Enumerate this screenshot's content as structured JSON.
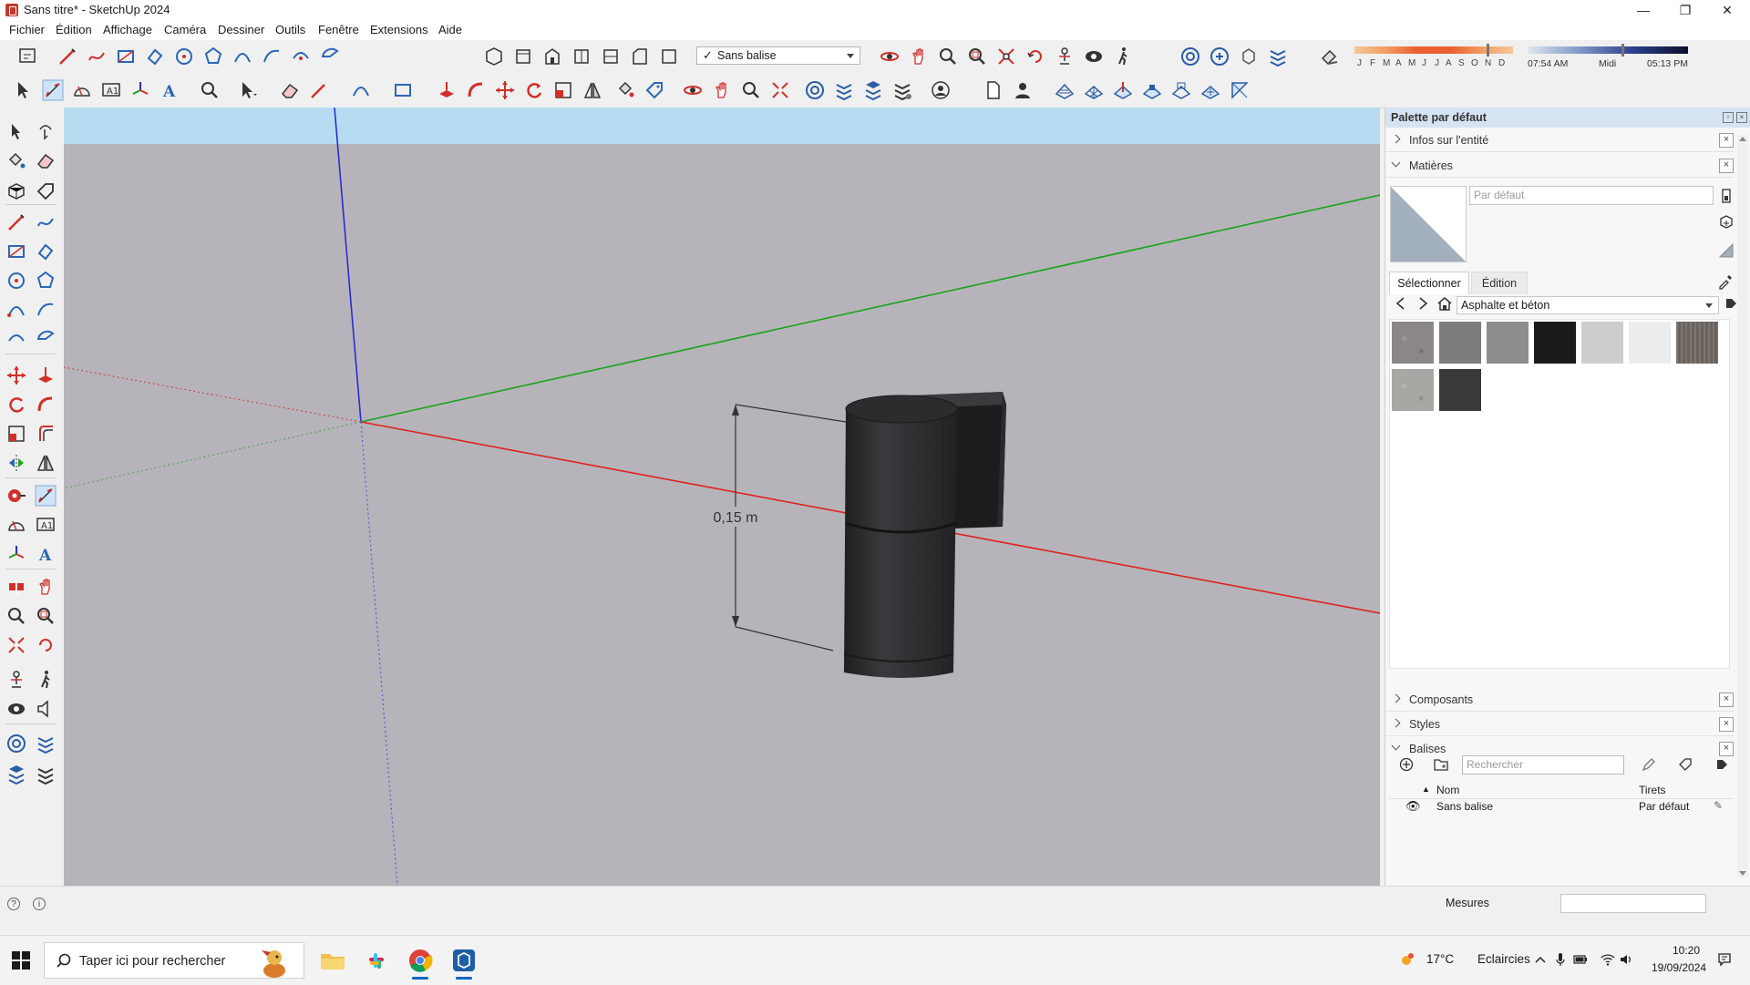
{
  "window": {
    "title": "Sans titre* - SketchUp 2024",
    "minimize": "—",
    "restore": "❐",
    "close": "✕"
  },
  "menu": [
    "Fichier",
    "Édition",
    "Affichage",
    "Caméra",
    "Dessiner",
    "Outils",
    "Fenêtre",
    "Extensions",
    "Aide"
  ],
  "toolbar": {
    "active_tag": "Sans balise",
    "months": [
      "J",
      "F",
      "M",
      "A",
      "M",
      "J",
      "J",
      "A",
      "S",
      "O",
      "N",
      "D"
    ],
    "time_start": "07:54 AM",
    "time_mid": "Midi",
    "time_end": "05:13 PM"
  },
  "viewport": {
    "dimension_label": "0,15 m",
    "colors": {
      "sky": "#b7dcf1",
      "ground": "#b6b4ba",
      "blue_axis": "#2b2bd8",
      "green_axis": "#1aa41a",
      "red_axis": "#e0221f",
      "model": "#2e2e30"
    }
  },
  "panel": {
    "title": "Palette par défaut",
    "trays": {
      "entity_info": "Infos sur l'entité",
      "materials": "Matières",
      "components": "Composants",
      "styles": "Styles",
      "tags": "Balises"
    },
    "materials": {
      "name_placeholder": "Par défaut",
      "tab_select": "Sélectionner",
      "tab_edit": "Édition",
      "library": "Asphalte et béton",
      "swatch_colors": [
        "#8b8787",
        "#7c7c7c",
        "#8d8d8d",
        "#1b1b1b",
        "#cdcdcd",
        "#ececec",
        "#6a625d",
        "#a6a8a3",
        "#3a383a"
      ]
    },
    "tags": {
      "search_placeholder": "Rechercher",
      "col_name": "Nom",
      "col_dashes": "Tirets",
      "rows": [
        {
          "name": "Sans balise",
          "dashes": "Par défaut"
        }
      ]
    }
  },
  "statusbar": {
    "measurements_label": "Mesures"
  },
  "taskbar": {
    "search_placeholder": "Taper ici pour rechercher",
    "temperature": "17°C",
    "weather": "Eclaircies",
    "time": "10:20",
    "date": "19/09/2024"
  }
}
